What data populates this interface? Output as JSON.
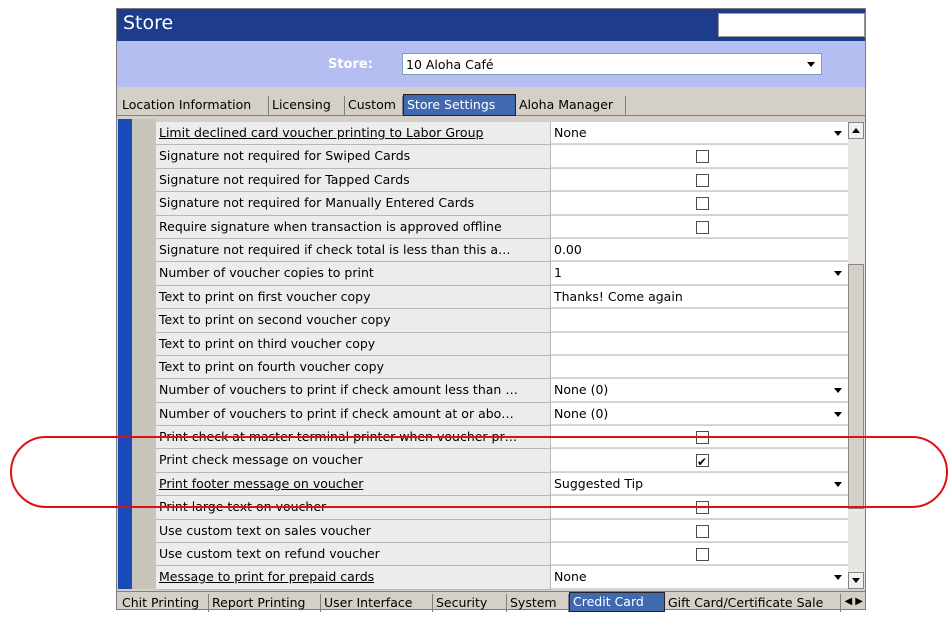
{
  "window": {
    "title": "Store"
  },
  "store": {
    "label": "Store:",
    "value": "10 Aloha Café"
  },
  "top_tabs": [
    {
      "label": "Location Information",
      "active": false
    },
    {
      "label": "Licensing",
      "active": false
    },
    {
      "label": "Custom",
      "active": false
    },
    {
      "label": "Store Settings",
      "active": true
    },
    {
      "label": "Aloha Manager",
      "active": false
    }
  ],
  "rows": [
    {
      "label": "Limit declined card voucher printing to Labor Group",
      "style": "u",
      "type": "dropdown",
      "value": "None"
    },
    {
      "label": "Signature not required for Swiped Cards",
      "type": "checkbox",
      "checked": false
    },
    {
      "label": "Signature not required for Tapped Cards",
      "type": "checkbox",
      "checked": false
    },
    {
      "label": "Signature not required for Manually Entered Cards",
      "type": "checkbox",
      "checked": false
    },
    {
      "label": "Require signature when transaction is approved offline",
      "type": "checkbox",
      "checked": false
    },
    {
      "label": "Signature not required if check total is less than this a…",
      "type": "text",
      "value": "0.00"
    },
    {
      "label": "Number of voucher copies to print",
      "type": "dropdown",
      "value": "1"
    },
    {
      "label": "Text to print on first voucher copy",
      "type": "text",
      "value": "Thanks!  Come again"
    },
    {
      "label": "Text to print on second voucher copy",
      "type": "text",
      "value": ""
    },
    {
      "label": "Text to print on third voucher copy",
      "type": "text",
      "value": ""
    },
    {
      "label": "Text to print on fourth voucher copy",
      "type": "text",
      "value": ""
    },
    {
      "label": "Number of vouchers to print if check amount less than …",
      "type": "dropdown",
      "value": "None (0)"
    },
    {
      "label": "Number of vouchers to print if check amount at or abo…",
      "type": "dropdown",
      "value": "None (0)"
    },
    {
      "label": "Print check at master terminal printer when voucher pr…",
      "style": "strike",
      "type": "checkbox",
      "checked": false
    },
    {
      "label": "Print check message on voucher",
      "type": "checkbox",
      "checked": true
    },
    {
      "label": "Print footer message on voucher",
      "style": "u",
      "type": "dropdown",
      "value": "Suggested Tip"
    },
    {
      "label": "Print large text on voucher",
      "style": "strike",
      "type": "checkbox",
      "checked": false
    },
    {
      "label": "Use custom text on sales voucher",
      "type": "checkbox",
      "checked": false
    },
    {
      "label": "Use custom text on refund voucher",
      "type": "checkbox",
      "checked": false
    },
    {
      "label": "Message to print for prepaid cards",
      "style": "u",
      "type": "dropdown",
      "value": "None"
    }
  ],
  "bottom_tabs": [
    {
      "label": "Chit Printing",
      "active": false
    },
    {
      "label": "Report Printing",
      "active": false
    },
    {
      "label": "User Interface",
      "active": false
    },
    {
      "label": "Security",
      "active": false
    },
    {
      "label": "System",
      "active": false
    },
    {
      "label": "Credit Card",
      "active": true
    },
    {
      "label": "Gift Card/Certificate Sale",
      "active": false
    }
  ],
  "colors": {
    "title_bar": "#1e3c8c",
    "store_bar": "#b4bef0",
    "active_tab": "#4169b0",
    "highlight": "#e01010"
  }
}
